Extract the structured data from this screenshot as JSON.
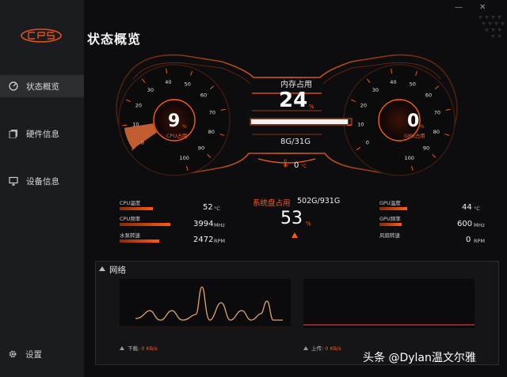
{
  "app": {
    "logo_text": "CPS",
    "page_title": "状态概览",
    "window_controls": {
      "minimize": "—",
      "close": "✕"
    }
  },
  "sidebar": {
    "items": [
      {
        "label": "状态概览",
        "icon": "dashboard-icon",
        "active": true
      },
      {
        "label": "硬件信息",
        "icon": "hardware-icon",
        "active": false
      },
      {
        "label": "设备信息",
        "icon": "monitor-icon",
        "active": false
      }
    ],
    "settings": {
      "label": "设置",
      "icon": "gear-icon"
    }
  },
  "cpu_gauge": {
    "value": "9",
    "unit": "%",
    "label": "CPU占用",
    "ticks": [
      "0",
      "10",
      "20",
      "30",
      "40",
      "50",
      "60",
      "70",
      "80",
      "90",
      "100"
    ],
    "level": 0.09
  },
  "gpu_gauge": {
    "value": "0",
    "unit": "%",
    "label": "GPU占用",
    "ticks": [
      "0",
      "10",
      "20",
      "30",
      "40",
      "50",
      "60",
      "70",
      "80",
      "90",
      "100"
    ],
    "level": 0.0
  },
  "memory": {
    "title": "内存占用",
    "percent": "24",
    "unit": "%",
    "usage": "8G/31G",
    "level": 0.24
  },
  "temperature": {
    "value": "0",
    "unit": "°C"
  },
  "cpu_stats": [
    {
      "label": "CPU温度",
      "value": "52",
      "unit": "°C",
      "level": 0.52
    },
    {
      "label": "CPU频率",
      "value": "3994",
      "unit": "MHz",
      "level": 0.8
    },
    {
      "label": "水泵转速",
      "value": "2472",
      "unit": "RPM",
      "level": 0.62
    }
  ],
  "gpu_stats": [
    {
      "label": "GPU温度",
      "value": "44",
      "unit": "°C",
      "level": 0.44
    },
    {
      "label": "GPU频率",
      "value": "600",
      "unit": "MHz",
      "level": 0.35
    },
    {
      "label": "风扇转速",
      "value": "0",
      "unit": "RPM",
      "level": 0.0
    }
  ],
  "disk": {
    "label": "系统盘占用",
    "usage": "502G/931G",
    "percent": "53",
    "unit": "%"
  },
  "network": {
    "title": "网络",
    "download_label": "下载:",
    "download_value": "0",
    "download_unit": "KB/s",
    "upload_label": "上传:",
    "upload_value": "0",
    "upload_unit": "KB/s"
  },
  "watermark": "头条 @Dylan温文尔雅",
  "colors": {
    "accent": "#ff5a14",
    "sidebar_bg": "#1b1c1f",
    "panel_bg": "#151518",
    "download_line": "#e0a56a",
    "upload_line": "#d83a2e"
  }
}
